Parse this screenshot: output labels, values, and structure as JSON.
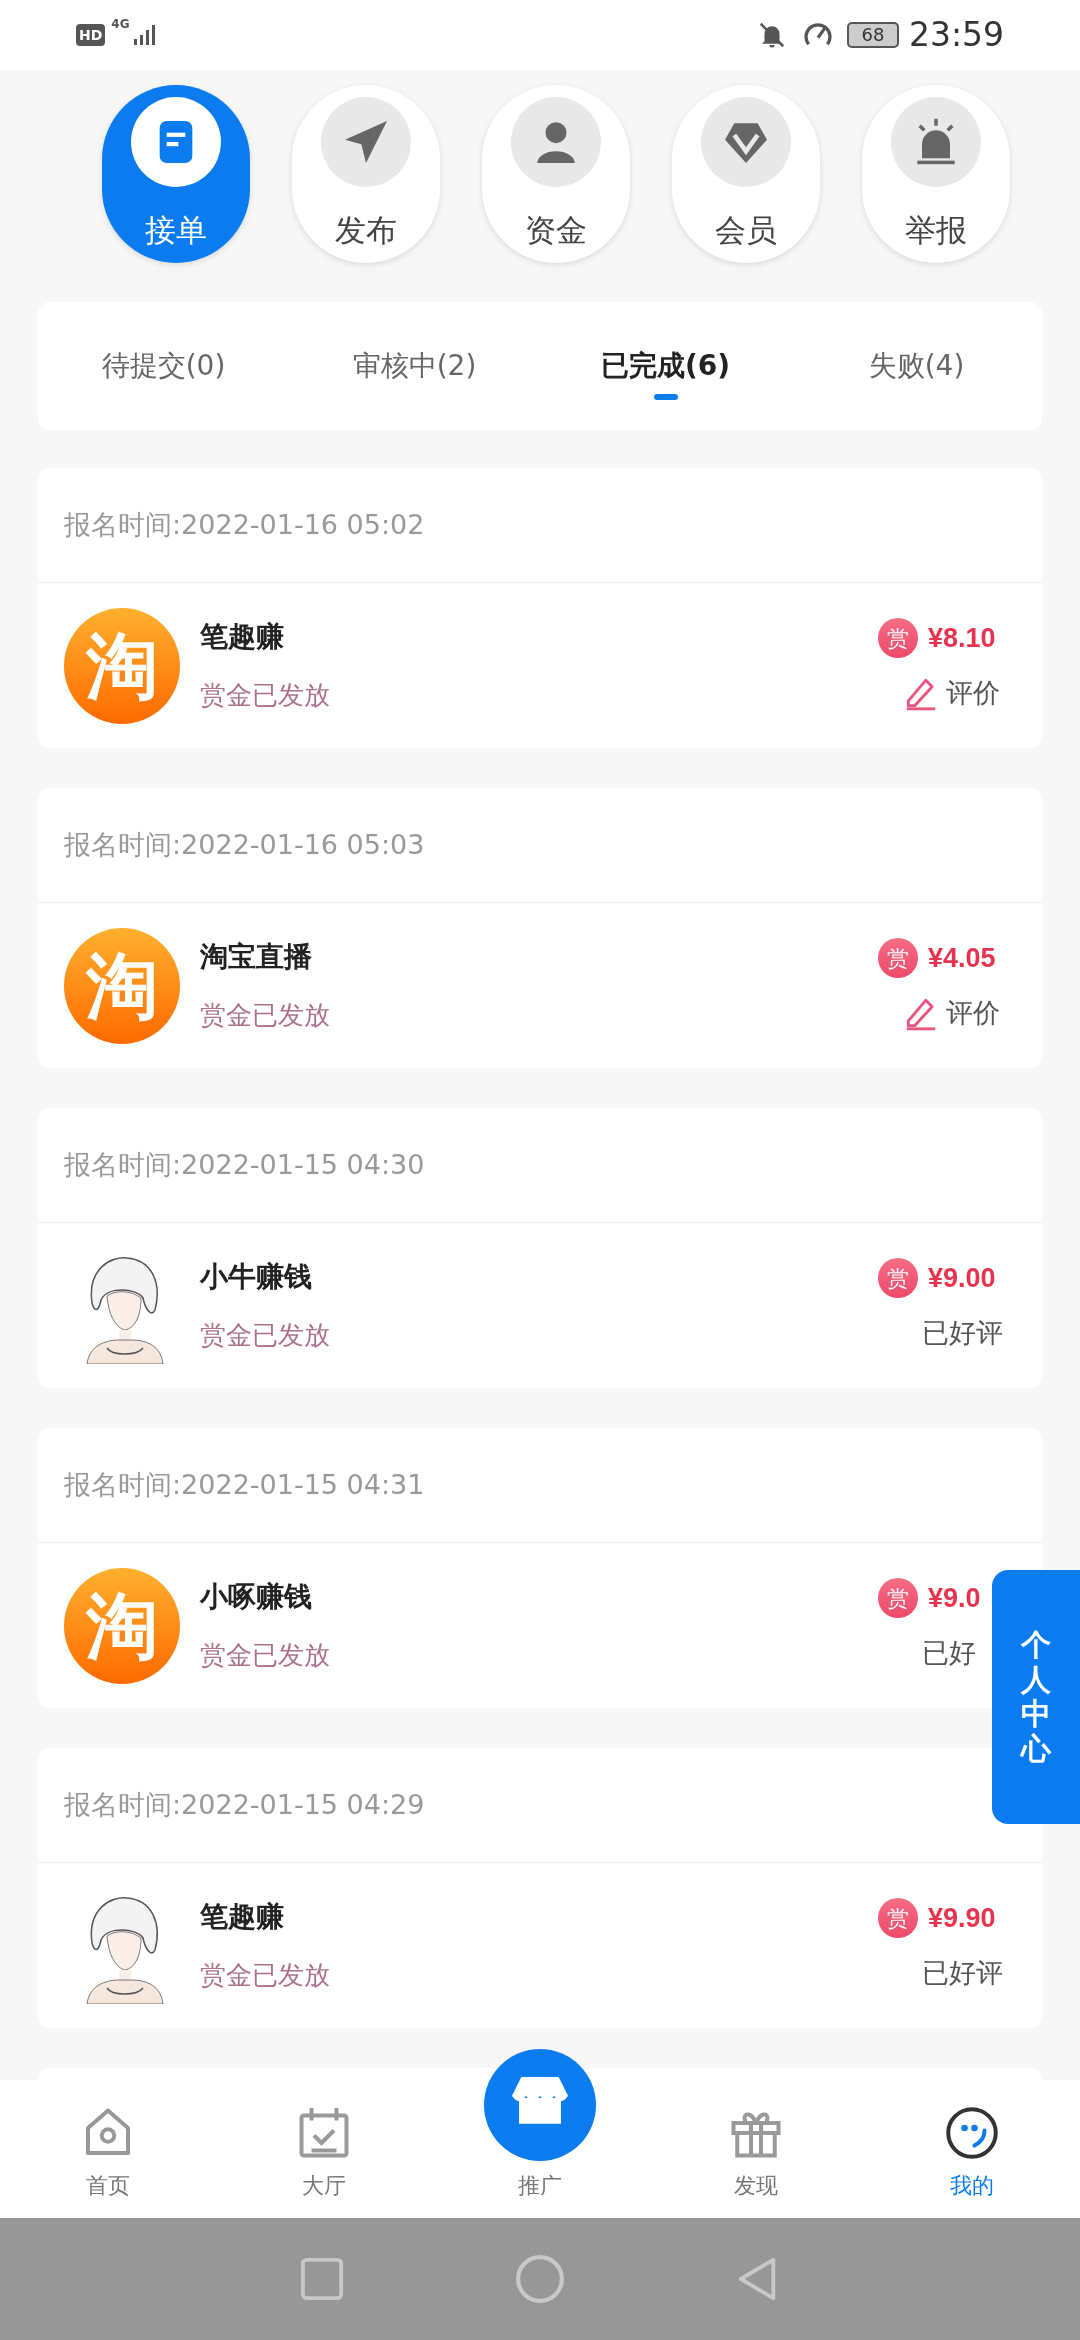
{
  "status_bar": {
    "hd": "HD",
    "network": "4G",
    "battery": "68",
    "time": "23:59"
  },
  "actions": [
    {
      "label": "接单",
      "selected": true
    },
    {
      "label": "发布",
      "selected": false
    },
    {
      "label": "资金",
      "selected": false
    },
    {
      "label": "会员",
      "selected": false
    },
    {
      "label": "举报",
      "selected": false
    }
  ],
  "tabs": [
    {
      "label": "待提交(0)",
      "selected": false
    },
    {
      "label": "审核中(2)",
      "selected": false
    },
    {
      "label": "已完成(6)",
      "selected": true
    },
    {
      "label": "失败(4)",
      "selected": false
    }
  ],
  "orders": [
    {
      "signup": "报名时间:2022-01-16 05:02",
      "avatar": {
        "kind": "logo",
        "text": "淘"
      },
      "name": "笔趣赚",
      "status": "赏金已发放",
      "badge": "赏",
      "amount": "¥8.10",
      "action": {
        "kind": "review",
        "label": "评价"
      }
    },
    {
      "signup": "报名时间:2022-01-16 05:03",
      "avatar": {
        "kind": "logo",
        "text": "淘"
      },
      "name": "淘宝直播",
      "status": "赏金已发放",
      "badge": "赏",
      "amount": "¥4.05",
      "action": {
        "kind": "review",
        "label": "评价"
      }
    },
    {
      "signup": "报名时间:2022-01-15 04:30",
      "name": "小牛赚钱",
      "status": "赏金已发放",
      "badge": "赏",
      "amount": "¥9.00",
      "action": {
        "kind": "done",
        "label": "已好评"
      }
    },
    {
      "signup": "报名时间:2022-01-15 04:31",
      "avatar": {
        "kind": "logo",
        "text": "淘"
      },
      "name": "小啄赚钱",
      "status": "赏金已发放",
      "badge": "赏",
      "amount": "¥9.0",
      "action": {
        "kind": "done",
        "label": "已好"
      }
    },
    {
      "signup": "报名时间:2022-01-15 04:29",
      "name": "笔趣赚",
      "status": "赏金已发放",
      "badge": "赏",
      "amount": "¥9.90",
      "action": {
        "kind": "done",
        "label": "已好评"
      }
    }
  ],
  "side_tab": "个人中心",
  "nav": [
    {
      "label": "首页",
      "selected": false
    },
    {
      "label": "大厅",
      "selected": false
    },
    {
      "label": "推广",
      "selected": false
    },
    {
      "label": "发现",
      "selected": false
    },
    {
      "label": "我的",
      "selected": true
    }
  ]
}
